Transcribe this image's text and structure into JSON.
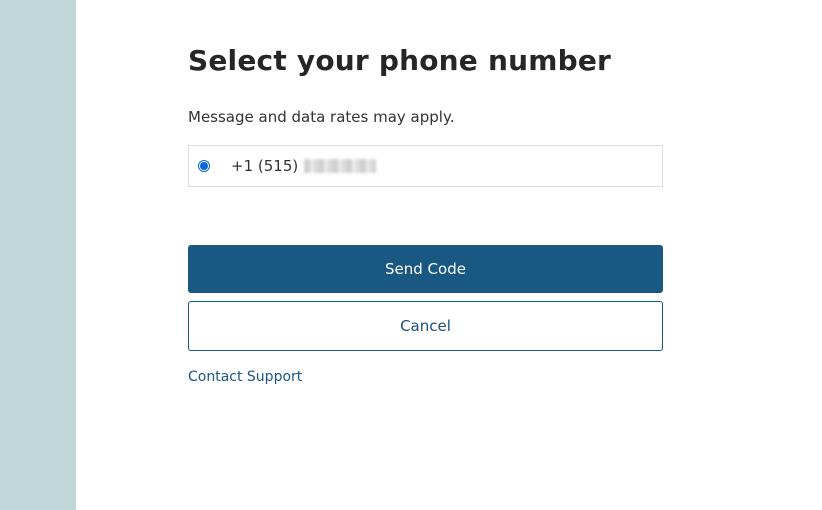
{
  "sidebar": {
    "color": "#bfd7d9"
  },
  "form": {
    "title": "Select your phone number",
    "notice": "Message and data rates may apply.",
    "phone_options": [
      {
        "label": "+1 (515)",
        "selected": true,
        "redacted": true
      }
    ],
    "send_code_label": "Send Code",
    "cancel_label": "Cancel",
    "support_link_label": "Contact Support"
  },
  "colors": {
    "primary_button": "#1a5884",
    "radio_accent": "#0a66d8",
    "link": "#1a5884"
  }
}
